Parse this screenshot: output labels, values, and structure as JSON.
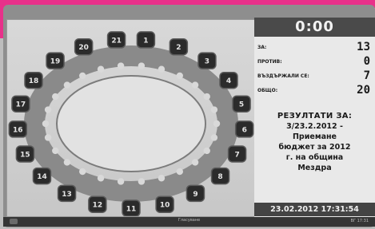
{
  "timer": "0:00",
  "results": {
    "za_label": "ЗА:",
    "za_value": "13",
    "protiv_label": "ПРОТИВ:",
    "protiv_value": "0",
    "vazd_label": "ВЪЗДЪРЖАЛИ СЕ:",
    "vazd_value": "7",
    "obshto_label": "ОБЩО:",
    "obshto_value": "20"
  },
  "resolution": {
    "title": "РЕЗУЛТАТИ ЗА:",
    "line1": "3/23.2.2012 -",
    "line2": "Приемане",
    "line3": "бюджет за 2012",
    "line4": "г. на община",
    "line5": "Мездра"
  },
  "datetime": "23.02.2012 17:31:54",
  "taskbar": {
    "center_text": "Гласуване",
    "right_text": "ВГ 17:31"
  },
  "seats": [
    {
      "num": "1"
    },
    {
      "num": "2"
    },
    {
      "num": "3"
    },
    {
      "num": "4"
    },
    {
      "num": "5"
    },
    {
      "num": "6"
    },
    {
      "num": "7"
    },
    {
      "num": "8"
    },
    {
      "num": "9"
    },
    {
      "num": "10"
    },
    {
      "num": "11"
    },
    {
      "num": "12"
    },
    {
      "num": "13"
    },
    {
      "num": "14"
    },
    {
      "num": "15"
    },
    {
      "num": "16"
    },
    {
      "num": "17"
    },
    {
      "num": "18"
    },
    {
      "num": "19"
    },
    {
      "num": "20"
    },
    {
      "num": "21"
    }
  ],
  "colors": {
    "seat_fill": "#2b2b2b",
    "ring": "#8a8a8a",
    "dot": "#d9d9d9",
    "panel_bg": "#e9e9e9",
    "bar_bg": "#4a4a4a",
    "accent_pink": "#e8318a"
  }
}
